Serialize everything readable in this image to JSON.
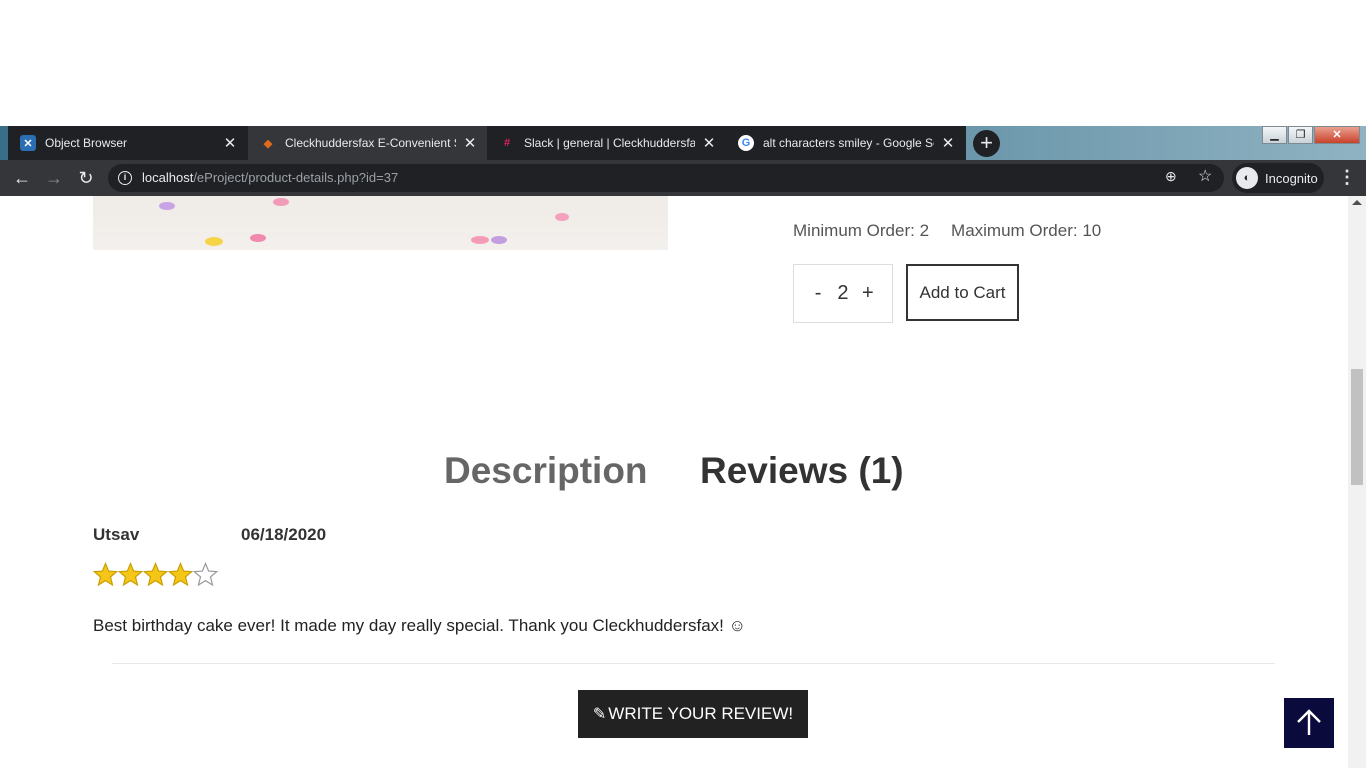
{
  "browser": {
    "tabs": [
      {
        "title": "Object Browser",
        "favicon": "object-browser-icon",
        "active": false
      },
      {
        "title": "Cleckhuddersfax E-Convenient Store",
        "favicon": "site-logo-icon",
        "active": true
      },
      {
        "title": "Slack | general | Cleckhuddersfax",
        "favicon": "slack-icon",
        "active": false
      },
      {
        "title": "alt characters smiley - Google Search",
        "favicon": "google-icon",
        "active": false
      }
    ],
    "close_glyph": "✕",
    "new_tab_glyph": "+",
    "url_host": "localhost",
    "url_path": "/eProject/product-details.php?id=37",
    "profile_label": "Incognito"
  },
  "product": {
    "min_order": "Minimum Order: 2",
    "max_order": "Maximum Order: 10",
    "quantity": "2",
    "minus": "-",
    "plus": "+",
    "add_to_cart": "Add to Cart"
  },
  "info_tabs": {
    "description": "Description",
    "reviews": "Reviews (1)"
  },
  "review": {
    "author": "Utsav",
    "date": "06/18/2020",
    "rating": 4,
    "max_rating": 5,
    "text": "Best birthday cake ever! It made my day really special. Thank you Cleckhuddersfax! ☺"
  },
  "write_review_label": "WRITE YOUR REVIEW!",
  "colors": {
    "star_fill": "#f5c518",
    "to_top_bg": "#0a0a3c",
    "button_dark": "#222222"
  }
}
